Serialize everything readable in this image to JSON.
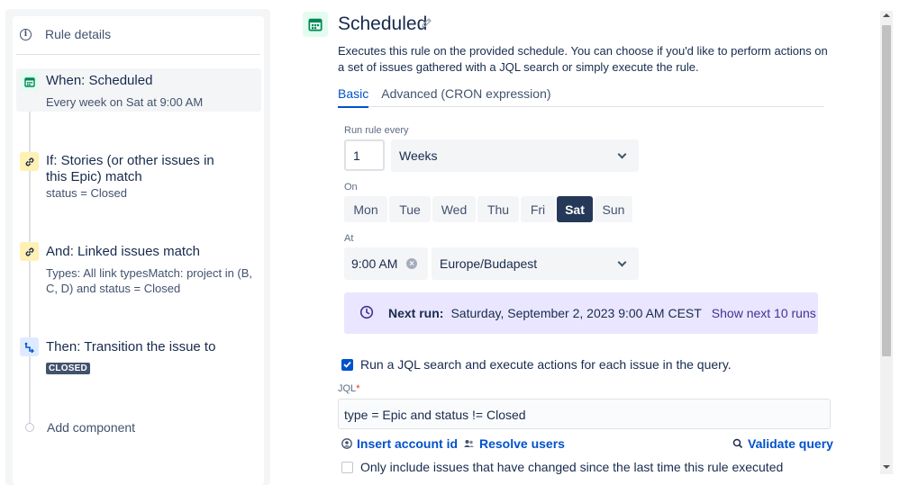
{
  "sidebar": {
    "rule_details_label": "Rule details",
    "components": [
      {
        "title": "When: Scheduled",
        "sub": "Every week on Sat at 9:00 AM",
        "icon": "calendar-icon",
        "color": "#36b37e"
      },
      {
        "title": "If: Stories (or other issues in this Epic) match",
        "sub": "status = Closed",
        "icon": "link-icon",
        "color": "#ffab00"
      },
      {
        "title": "And: Linked issues match",
        "sub": "Types: All link typesMatch: project in (B, C, D) and status = Closed",
        "icon": "link-icon",
        "color": "#ffab00"
      },
      {
        "title": "Then: Transition the issue to",
        "lozenge": "CLOSED",
        "icon": "transition-icon",
        "color": "#0065ff"
      }
    ],
    "add_component_label": "Add component"
  },
  "header": {
    "title": "Scheduled",
    "description": "Executes this rule on the provided schedule. You can choose if you'd like to perform actions on a set of issues gathered with a JQL search or simply execute the rule."
  },
  "tabs": [
    {
      "label": "Basic",
      "active": true
    },
    {
      "label": "Advanced (CRON expression)",
      "active": false
    }
  ],
  "form": {
    "run_every_label": "Run rule every",
    "interval_value": "1",
    "interval_unit": "Weeks",
    "on_label": "On",
    "days": [
      {
        "label": "Mon",
        "selected": false
      },
      {
        "label": "Tue",
        "selected": false
      },
      {
        "label": "Wed",
        "selected": false
      },
      {
        "label": "Thu",
        "selected": false
      },
      {
        "label": "Fri",
        "selected": false
      },
      {
        "label": "Sat",
        "selected": true
      },
      {
        "label": "Sun",
        "selected": false
      }
    ],
    "at_label": "At",
    "time_value": "9:00 AM",
    "timezone": "Europe/Budapest",
    "next_run_label": "Next run:",
    "next_run_value": "Saturday, September 2, 2023 9:00 AM CEST",
    "show_next_label": "Show next 10 runs",
    "jql_checkbox_label": "Run a JQL search and execute actions for each issue in the query.",
    "jql_checkbox_checked": true,
    "jql_label": "JQL",
    "jql_required_mark": "*",
    "jql_value": "type = Epic and status != Closed",
    "insert_account_label": "Insert account id",
    "resolve_users_label": "Resolve users",
    "validate_label": "Validate query",
    "changed_checkbox_label": "Only include issues that have changed since the last time this rule executed",
    "changed_checkbox_checked": false
  },
  "colors": {
    "primary": "#0052cc",
    "selected_day": "#253858",
    "next_run_bg": "#eae6ff"
  }
}
